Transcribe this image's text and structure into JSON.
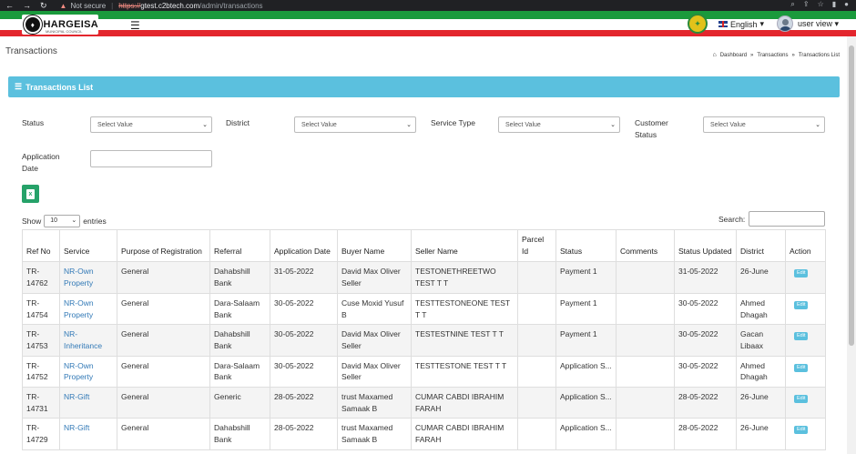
{
  "browser": {
    "nav_icons": [
      "back-arrow",
      "forward-arrow",
      "reload"
    ],
    "security_label": "Not secure",
    "url_protocol": "https://",
    "url_host": "gtest.c2btech.com",
    "url_path": "/admin/transactions"
  },
  "header": {
    "logo_text": "HARGEISA",
    "logo_subtext": "MUNICIPAL COUNCIL",
    "language": "English",
    "user": "user view"
  },
  "page": {
    "title": "Transactions",
    "breadcrumb": [
      "Dashboard",
      "Transactions",
      "Transactions List"
    ]
  },
  "panel": {
    "title": "Transactions List"
  },
  "filters": {
    "status_label": "Status",
    "district_label": "District",
    "service_type_label": "Service Type",
    "customer_status_label_1": "Customer",
    "customer_status_label_2": "Status",
    "application_date_label_1": "Application",
    "application_date_label_2": "Date",
    "select_placeholder": "Select Value"
  },
  "table_controls": {
    "show_label": "Show",
    "entries_value": "10",
    "entries_label": "entries",
    "search_label": "Search:"
  },
  "table": {
    "headers": {
      "ref_no": "Ref No",
      "service": "Service",
      "purpose": "Purpose of Registration",
      "referral": "Referral",
      "app_date": "Application Date",
      "buyer": "Buyer Name",
      "seller": "Seller Name",
      "parcel_1": "Parcel",
      "parcel_2": "Id",
      "status": "Status",
      "comments": "Comments",
      "status_updated": "Status Updated",
      "district": "District",
      "action": "Action"
    },
    "edit_label": "Edit",
    "rows": [
      {
        "ref": "TR-14762",
        "service": "NR-Own Property",
        "purpose": "General",
        "referral": "Dahabshill Bank",
        "app_date": "31-05-2022",
        "buyer": "David Max Oliver Seller",
        "seller": "TESTONETHREETWO TEST T T",
        "parcel": "",
        "status": "Payment 1",
        "comments": "",
        "updated": "31-05-2022",
        "district": "26-June"
      },
      {
        "ref": "TR-14754",
        "service": "NR-Own Property",
        "purpose": "General",
        "referral": "Dara-Salaam Bank",
        "app_date": "30-05-2022",
        "buyer": "Cuse Moxid Yusuf B",
        "seller": "TESTTESTONEONE TEST T T",
        "parcel": "",
        "status": "Payment 1",
        "comments": "",
        "updated": "30-05-2022",
        "district": "Ahmed Dhagah"
      },
      {
        "ref": "TR-14753",
        "service": "NR-Inheritance",
        "purpose": "General",
        "referral": "Dahabshill Bank",
        "app_date": "30-05-2022",
        "buyer": "David Max Oliver Seller",
        "seller": "TESTESTNINE TEST T T",
        "parcel": "",
        "status": "Payment 1",
        "comments": "",
        "updated": "30-05-2022",
        "district": "Gacan Libaax"
      },
      {
        "ref": "TR-14752",
        "service": "NR-Own Property",
        "purpose": "General",
        "referral": "Dara-Salaam Bank",
        "app_date": "30-05-2022",
        "buyer": "David Max Oliver Seller",
        "seller": "TESTTESTONE TEST T T",
        "parcel": "",
        "status": "Application S...",
        "comments": "",
        "updated": "30-05-2022",
        "district": "Ahmed Dhagah"
      },
      {
        "ref": "TR-14731",
        "service": "NR-Gift",
        "purpose": "General",
        "referral": "Generic",
        "app_date": "28-05-2022",
        "buyer": "trust Maxamed Samaak B",
        "seller": "CUMAR CABDI IBRAHIM FARAH",
        "parcel": "",
        "status": "Application S...",
        "comments": "",
        "updated": "28-05-2022",
        "district": "26-June"
      },
      {
        "ref": "TR-14729",
        "service": "NR-Gift",
        "purpose": "General",
        "referral": "Dahabshill Bank",
        "app_date": "28-05-2022",
        "buyer": "trust Maxamed Samaak B",
        "seller": "CUMAR CABDI IBRAHIM FARAH",
        "parcel": "",
        "status": "Application S...",
        "comments": "",
        "updated": "28-05-2022",
        "district": "26-June"
      }
    ]
  },
  "colors": {
    "panel_header": "#5bc0de",
    "stripe_green": "#1a9a3c",
    "stripe_red": "#e3262d",
    "link": "#337ab7",
    "excel_button": "#26a269"
  }
}
